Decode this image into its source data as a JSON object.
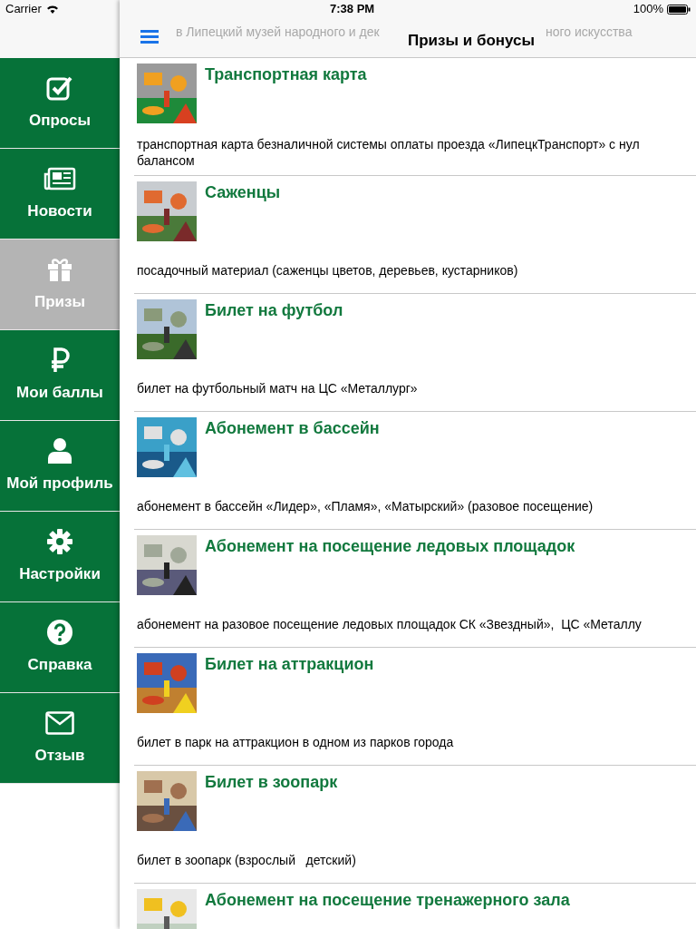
{
  "status_bar": {
    "carrier": "Carrier",
    "time": "7:38 PM",
    "battery": "100%"
  },
  "sidebar": {
    "items": [
      {
        "label": "Опросы",
        "selected": false
      },
      {
        "label": "Новости",
        "selected": false
      },
      {
        "label": "Призы",
        "selected": true
      },
      {
        "label": "Мои баллы",
        "selected": false
      },
      {
        "label": "Мой профиль",
        "selected": false
      },
      {
        "label": "Настройки",
        "selected": false
      },
      {
        "label": "Справка",
        "selected": false
      },
      {
        "label": "Отзыв",
        "selected": false
      }
    ]
  },
  "nav_bar": {
    "title": "Призы и бонусы",
    "scrolled_under": [
      "в Липецкий музей народного и дек",
      "ного искусства"
    ]
  },
  "prizes": [
    {
      "title": "Транспортная карта",
      "description": [
        "транспортная карта безналичной системы оплаты проезда «ЛипецкТранспорт» с нул",
        "балансом"
      ]
    },
    {
      "title": "Саженцы",
      "description": [
        "посадочный материал (саженцы цветов, деревьев, кустарников)"
      ]
    },
    {
      "title": "Билет на футбол",
      "description": [
        "билет на футбольный матч на ЦС «Металлург»"
      ]
    },
    {
      "title": "Абонемент в бассейн",
      "description": [
        "абонемент в бассейн «Лидер», «Пламя», «Матырский» (разовое посещение)"
      ]
    },
    {
      "title": "Абонемент на посещение ледовых площадок",
      "description": [
        "абонемент на разовое посещение ледовых площадок СК «Звездный»,  ЦС «Металлу"
      ]
    },
    {
      "title": "Билет на аттракцион",
      "description": [
        "билет в парк на аттракцион в одном из парков города"
      ]
    },
    {
      "title": "Билет в зоопарк",
      "description": [
        "билет в зоопарк (взрослый   детский)"
      ]
    },
    {
      "title": "Абонемент на посещение тренажерного зала"
    }
  ]
}
